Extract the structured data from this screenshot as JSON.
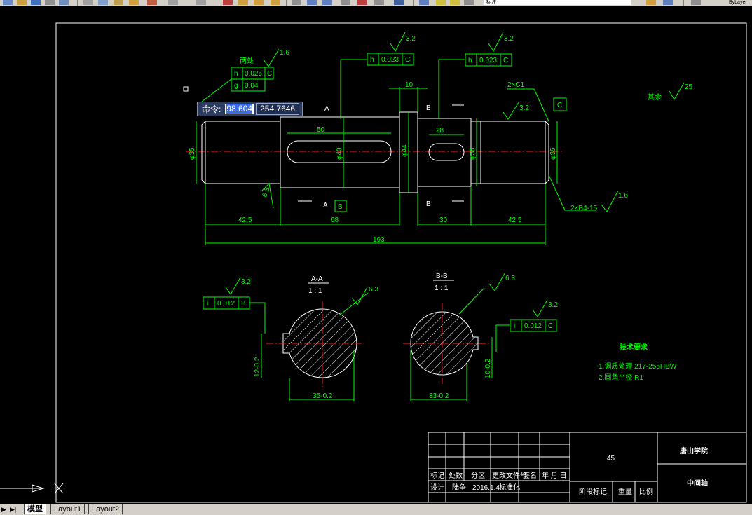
{
  "toolbar": {
    "layer_name": "标注",
    "right_label": "ByLayer"
  },
  "command_tip": {
    "label": "命令:",
    "x_value": "98.604",
    "y_value": "254.7646"
  },
  "drawing": {
    "top_note": "两处",
    "fcf": [
      {
        "sym": "h",
        "tol": "0.025",
        "datum": "C"
      },
      {
        "sym": "g",
        "tol": "0.04"
      },
      {
        "sym": "h",
        "tol": "0.023",
        "datum": "C"
      },
      {
        "sym": "h",
        "tol": "0.023",
        "datum": "C"
      },
      {
        "sym": "i",
        "tol": "0.012",
        "datum": "B"
      },
      {
        "sym": "i",
        "tol": "0.012",
        "datum": "C"
      }
    ],
    "roughness": {
      "r16": "1.6",
      "r32": "3.2",
      "r63": "6.3",
      "r25": "25"
    },
    "section_a": "A",
    "section_b": "B",
    "datum_c": "C",
    "datum_b": "B",
    "chamfer": "2×C1",
    "center_holes": "2×B4-15",
    "other": "其余",
    "dims": {
      "d10": "10",
      "d50": "50",
      "d28": "28",
      "d42_5a": "42.5",
      "d68": "68",
      "d30": "30",
      "d42_5b": "42.5",
      "d193": "193",
      "dia35a": "φ35",
      "dia40": "φ40",
      "dia44": "φ44",
      "dia38": "φ38",
      "dia35b": "φ35",
      "sec_a_w": "35-0.2",
      "sec_b_w": "33-0.2",
      "sec_a_h": "12-0.2",
      "sec_b_h": "10-0.2"
    },
    "section_labels": {
      "aa": "A-A",
      "bb": "B-B",
      "scale": "1 : 1"
    },
    "tech": {
      "title": "技术要求",
      "line1": "1.调质处理 217-255HBW",
      "line2": "2.圆角半径 R1"
    },
    "title_block": {
      "material": "45",
      "school": "唐山学院",
      "part": "中间轴",
      "h1": "标记",
      "h2": "处数",
      "h3": "分区",
      "h4": "更改文件号",
      "h5": "签名",
      "h6": "年 月 日",
      "designer_lbl": "设计",
      "designer": "陆争",
      "date": "2016.1.4",
      "std_lbl": "标准化",
      "stage": "阶段标记",
      "weight": "重量",
      "scale": "比例"
    }
  },
  "tabs": [
    {
      "label": "模型",
      "active": true
    },
    {
      "label": "Layout1",
      "active": false
    },
    {
      "label": "Layout2",
      "active": false
    }
  ],
  "colors": {
    "line": "#00ff00",
    "outline": "#ffffff",
    "center": "#ff2020",
    "tech": "#ffd040"
  }
}
